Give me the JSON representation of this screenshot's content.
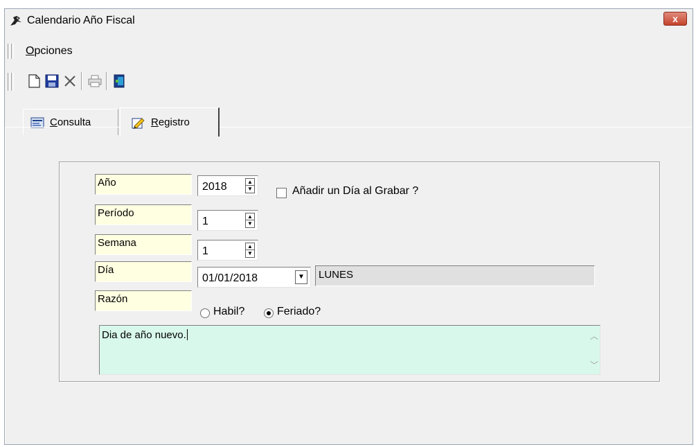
{
  "window": {
    "title": "Calendario Año Fiscal",
    "close_glyph": "x"
  },
  "menu": {
    "items": [
      {
        "label_underlined": "O",
        "label_rest": "pciones"
      }
    ]
  },
  "toolbar": {
    "icons": [
      "new-document-icon",
      "save-icon",
      "delete-icon",
      "print-icon",
      "exit-icon"
    ]
  },
  "tabs": [
    {
      "label_underlined": "C",
      "label_rest": "onsulta",
      "icon": "consulta-icon",
      "active": false
    },
    {
      "label_underlined": "R",
      "label_rest": "egistro",
      "icon": "registro-icon",
      "active": true
    }
  ],
  "form": {
    "anio": {
      "label": "Año",
      "value": "2018"
    },
    "add_day": {
      "label": "Añadir un Día al Grabar  ?",
      "checked": false
    },
    "periodo": {
      "label": "Período",
      "value": "1"
    },
    "semana": {
      "label": "Semana",
      "value": "1"
    },
    "dia": {
      "label": "Día",
      "value": "01/01/2018",
      "day_name": "LUNES"
    },
    "razon": {
      "label": "Razón",
      "options": [
        {
          "label": "Habil?",
          "selected": false
        },
        {
          "label": "Feriado?",
          "selected": true
        }
      ]
    },
    "notes": "Dia de año nuevo."
  },
  "colors": {
    "label_bg": "#ffffe1",
    "notes_bg": "#d8f8ec",
    "close_red": "#c4432c"
  }
}
